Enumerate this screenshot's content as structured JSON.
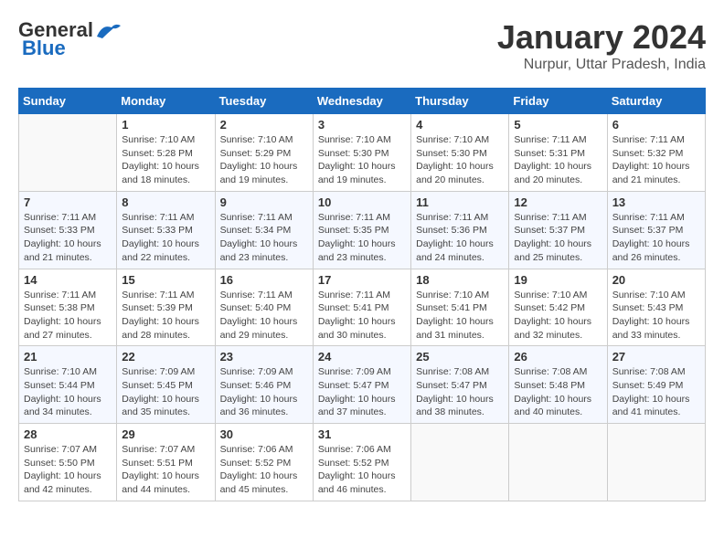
{
  "header": {
    "logo_general": "General",
    "logo_blue": "Blue",
    "month_title": "January 2024",
    "location": "Nurpur, Uttar Pradesh, India"
  },
  "weekdays": [
    "Sunday",
    "Monday",
    "Tuesday",
    "Wednesday",
    "Thursday",
    "Friday",
    "Saturday"
  ],
  "weeks": [
    [
      {
        "day": "",
        "info": ""
      },
      {
        "day": "1",
        "info": "Sunrise: 7:10 AM\nSunset: 5:28 PM\nDaylight: 10 hours\nand 18 minutes."
      },
      {
        "day": "2",
        "info": "Sunrise: 7:10 AM\nSunset: 5:29 PM\nDaylight: 10 hours\nand 19 minutes."
      },
      {
        "day": "3",
        "info": "Sunrise: 7:10 AM\nSunset: 5:30 PM\nDaylight: 10 hours\nand 19 minutes."
      },
      {
        "day": "4",
        "info": "Sunrise: 7:10 AM\nSunset: 5:30 PM\nDaylight: 10 hours\nand 20 minutes."
      },
      {
        "day": "5",
        "info": "Sunrise: 7:11 AM\nSunset: 5:31 PM\nDaylight: 10 hours\nand 20 minutes."
      },
      {
        "day": "6",
        "info": "Sunrise: 7:11 AM\nSunset: 5:32 PM\nDaylight: 10 hours\nand 21 minutes."
      }
    ],
    [
      {
        "day": "7",
        "info": "Sunrise: 7:11 AM\nSunset: 5:33 PM\nDaylight: 10 hours\nand 21 minutes."
      },
      {
        "day": "8",
        "info": "Sunrise: 7:11 AM\nSunset: 5:33 PM\nDaylight: 10 hours\nand 22 minutes."
      },
      {
        "day": "9",
        "info": "Sunrise: 7:11 AM\nSunset: 5:34 PM\nDaylight: 10 hours\nand 23 minutes."
      },
      {
        "day": "10",
        "info": "Sunrise: 7:11 AM\nSunset: 5:35 PM\nDaylight: 10 hours\nand 23 minutes."
      },
      {
        "day": "11",
        "info": "Sunrise: 7:11 AM\nSunset: 5:36 PM\nDaylight: 10 hours\nand 24 minutes."
      },
      {
        "day": "12",
        "info": "Sunrise: 7:11 AM\nSunset: 5:37 PM\nDaylight: 10 hours\nand 25 minutes."
      },
      {
        "day": "13",
        "info": "Sunrise: 7:11 AM\nSunset: 5:37 PM\nDaylight: 10 hours\nand 26 minutes."
      }
    ],
    [
      {
        "day": "14",
        "info": "Sunrise: 7:11 AM\nSunset: 5:38 PM\nDaylight: 10 hours\nand 27 minutes."
      },
      {
        "day": "15",
        "info": "Sunrise: 7:11 AM\nSunset: 5:39 PM\nDaylight: 10 hours\nand 28 minutes."
      },
      {
        "day": "16",
        "info": "Sunrise: 7:11 AM\nSunset: 5:40 PM\nDaylight: 10 hours\nand 29 minutes."
      },
      {
        "day": "17",
        "info": "Sunrise: 7:11 AM\nSunset: 5:41 PM\nDaylight: 10 hours\nand 30 minutes."
      },
      {
        "day": "18",
        "info": "Sunrise: 7:10 AM\nSunset: 5:41 PM\nDaylight: 10 hours\nand 31 minutes."
      },
      {
        "day": "19",
        "info": "Sunrise: 7:10 AM\nSunset: 5:42 PM\nDaylight: 10 hours\nand 32 minutes."
      },
      {
        "day": "20",
        "info": "Sunrise: 7:10 AM\nSunset: 5:43 PM\nDaylight: 10 hours\nand 33 minutes."
      }
    ],
    [
      {
        "day": "21",
        "info": "Sunrise: 7:10 AM\nSunset: 5:44 PM\nDaylight: 10 hours\nand 34 minutes."
      },
      {
        "day": "22",
        "info": "Sunrise: 7:09 AM\nSunset: 5:45 PM\nDaylight: 10 hours\nand 35 minutes."
      },
      {
        "day": "23",
        "info": "Sunrise: 7:09 AM\nSunset: 5:46 PM\nDaylight: 10 hours\nand 36 minutes."
      },
      {
        "day": "24",
        "info": "Sunrise: 7:09 AM\nSunset: 5:47 PM\nDaylight: 10 hours\nand 37 minutes."
      },
      {
        "day": "25",
        "info": "Sunrise: 7:08 AM\nSunset: 5:47 PM\nDaylight: 10 hours\nand 38 minutes."
      },
      {
        "day": "26",
        "info": "Sunrise: 7:08 AM\nSunset: 5:48 PM\nDaylight: 10 hours\nand 40 minutes."
      },
      {
        "day": "27",
        "info": "Sunrise: 7:08 AM\nSunset: 5:49 PM\nDaylight: 10 hours\nand 41 minutes."
      }
    ],
    [
      {
        "day": "28",
        "info": "Sunrise: 7:07 AM\nSunset: 5:50 PM\nDaylight: 10 hours\nand 42 minutes."
      },
      {
        "day": "29",
        "info": "Sunrise: 7:07 AM\nSunset: 5:51 PM\nDaylight: 10 hours\nand 44 minutes."
      },
      {
        "day": "30",
        "info": "Sunrise: 7:06 AM\nSunset: 5:52 PM\nDaylight: 10 hours\nand 45 minutes."
      },
      {
        "day": "31",
        "info": "Sunrise: 7:06 AM\nSunset: 5:52 PM\nDaylight: 10 hours\nand 46 minutes."
      },
      {
        "day": "",
        "info": ""
      },
      {
        "day": "",
        "info": ""
      },
      {
        "day": "",
        "info": ""
      }
    ]
  ]
}
